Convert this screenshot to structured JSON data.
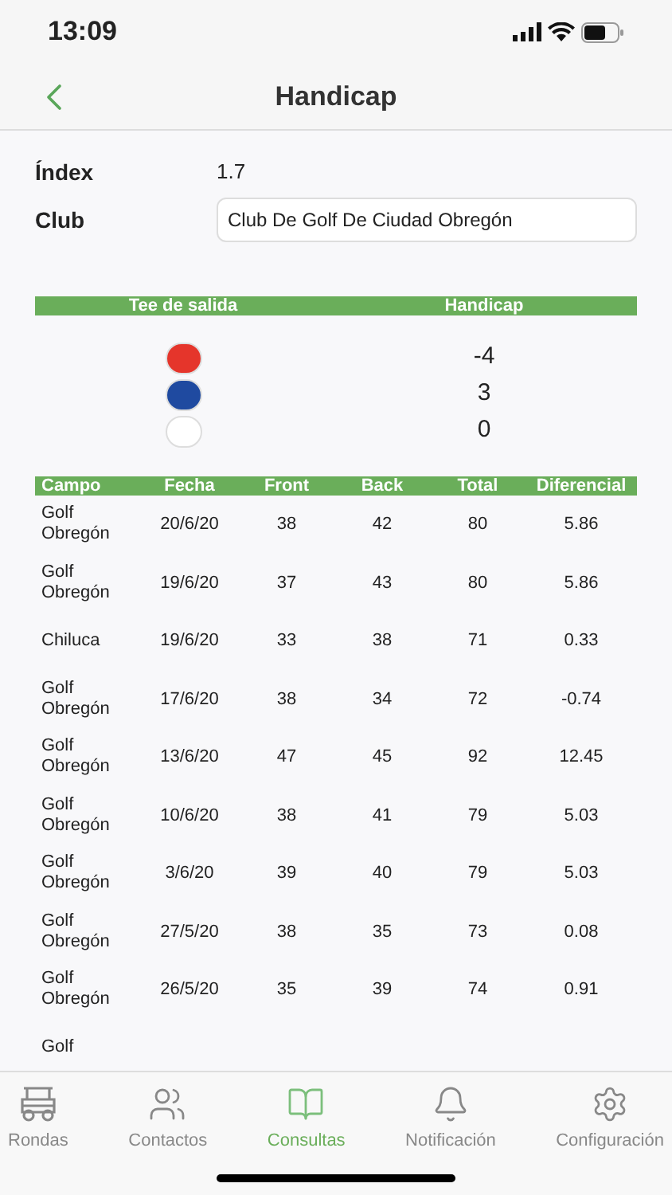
{
  "status_bar": {
    "time": "13:09"
  },
  "nav": {
    "title": "Handicap"
  },
  "index": {
    "label": "Índex",
    "value": "1.7"
  },
  "club": {
    "label": "Club",
    "value": "Club De Golf De Ciudad Obregón"
  },
  "tees": {
    "columns": [
      "Tee de salida",
      "Handicap"
    ],
    "rows": [
      {
        "color": "#e5352b",
        "handicap": "-4"
      },
      {
        "color": "#1f4aa0",
        "handicap": "3"
      },
      {
        "color": "#ffffff",
        "handicap": "0"
      }
    ]
  },
  "rounds": {
    "columns": [
      "Campo",
      "Fecha",
      "Front",
      "Back",
      "Total",
      "Diferencial"
    ],
    "rows": [
      [
        "Golf Obregón",
        "20/6/20",
        "38",
        "42",
        "80",
        "5.86"
      ],
      [
        "Golf Obregón",
        "19/6/20",
        "37",
        "43",
        "80",
        "5.86"
      ],
      [
        "Chiluca",
        "19/6/20",
        "33",
        "38",
        "71",
        "0.33"
      ],
      [
        "Golf Obregón",
        "17/6/20",
        "38",
        "34",
        "72",
        "-0.74"
      ],
      [
        "Golf Obregón",
        "13/6/20",
        "47",
        "45",
        "92",
        "12.45"
      ],
      [
        "Golf Obregón",
        "10/6/20",
        "38",
        "41",
        "79",
        "5.03"
      ],
      [
        "Golf Obregón",
        "3/6/20",
        "39",
        "40",
        "79",
        "5.03"
      ],
      [
        "Golf Obregón",
        "27/5/20",
        "38",
        "35",
        "73",
        "0.08"
      ],
      [
        "Golf Obregón",
        "26/5/20",
        "35",
        "39",
        "74",
        "0.91"
      ],
      [
        "Golf"
      ]
    ]
  },
  "tab_bar": [
    {
      "label": "Rondas",
      "selected": false
    },
    {
      "label": "Contactos",
      "selected": false
    },
    {
      "label": "Consultas",
      "selected": true
    },
    {
      "label": "Notificación",
      "selected": false
    },
    {
      "label": "Configuración",
      "selected": false
    }
  ]
}
